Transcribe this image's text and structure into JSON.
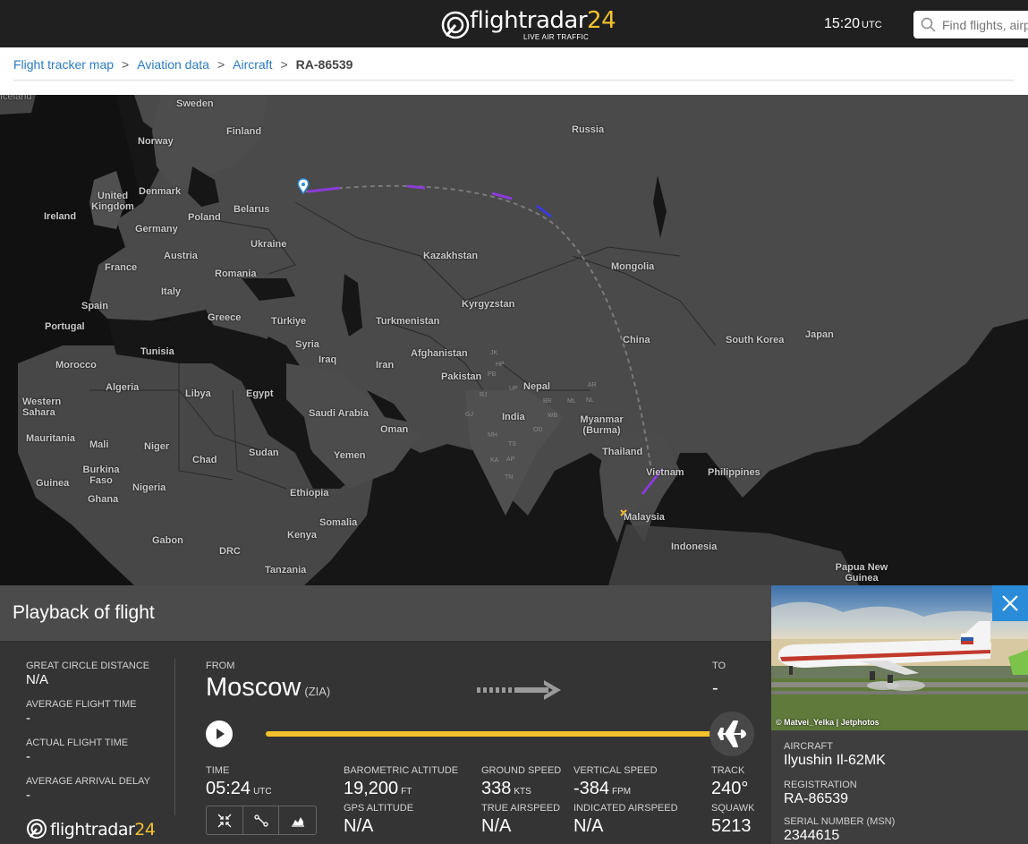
{
  "header": {
    "logo_text": "flightradar",
    "logo_num": "24",
    "logo_sub": "LIVE AIR TRAFFIC",
    "time": "15:20",
    "time_zone": "UTC",
    "search_placeholder": "Find flights, airports"
  },
  "breadcrumb": {
    "items": [
      "Flight tracker map",
      "Aviation data",
      "Aircraft"
    ],
    "current": "RA-86539",
    "separator": ">"
  },
  "map": {
    "countries": [
      "Iceland",
      "Sweden",
      "Finland",
      "Norway",
      "Russia",
      "United Kingdom",
      "Denmark",
      "Ireland",
      "Belarus",
      "Poland",
      "Germany",
      "Ukraine",
      "France",
      "Austria",
      "Romania",
      "Kazakhstan",
      "Mongolia",
      "Italy",
      "Spain",
      "Greece",
      "Portugal",
      "Türkiye",
      "Turkmenistan",
      "Kyrgyzstan",
      "Syria",
      "Tunisia",
      "Iraq",
      "Afghanistan",
      "Iran",
      "Morocco",
      "Algeria",
      "Libya",
      "Egypt",
      "Pakistan",
      "Nepal",
      "China",
      "South Korea",
      "Japan",
      "Western Sahara",
      "India",
      "Saudi Arabia",
      "Oman",
      "Myanmar (Burma)",
      "Mauritania",
      "Mali",
      "Niger",
      "Chad",
      "Sudan",
      "Yemen",
      "Thailand",
      "Burkina Faso",
      "Guinea",
      "Nigeria",
      "Ethiopia",
      "Ghana",
      "Vietnam",
      "Philippines",
      "Somalia",
      "Malaysia",
      "Gabon",
      "Kenya",
      "DRC",
      "Indonesia",
      "Tanzania",
      "Papua New Guinea"
    ],
    "states": [
      "JK",
      "HP",
      "PB",
      "UP",
      "RJ",
      "GJ",
      "MH",
      "TS",
      "KA",
      "AP",
      "TN",
      "BR",
      "WB",
      "AR",
      "ML",
      "NL",
      "OD"
    ]
  },
  "playback": {
    "title": "Playback of flight",
    "great_circle_label": "GREAT CIRCLE DISTANCE",
    "great_circle_value": "N/A",
    "avg_flight_time_label": "AVERAGE FLIGHT TIME",
    "avg_flight_time_value": "-",
    "actual_flight_time_label": "ACTUAL FLIGHT TIME",
    "actual_flight_time_value": "-",
    "avg_arrival_delay_label": "AVERAGE ARRIVAL DELAY",
    "avg_arrival_delay_value": "-",
    "from_label": "FROM",
    "from_city": "Moscow",
    "from_code": "(ZIA)",
    "to_label": "TO",
    "to_value": "-",
    "progress": 1.0,
    "time_label": "TIME",
    "time_value": "05:24",
    "time_unit": "UTC",
    "baro_alt_label": "BAROMETRIC ALTITUDE",
    "baro_alt_value": "19,200",
    "baro_alt_unit": "FT",
    "gps_alt_label": "GPS ALTITUDE",
    "gps_alt_value": "N/A",
    "ground_speed_label": "GROUND SPEED",
    "ground_speed_value": "338",
    "ground_speed_unit": "KTS",
    "true_airspeed_label": "TRUE AIRSPEED",
    "true_airspeed_value": "N/A",
    "vertical_speed_label": "VERTICAL SPEED",
    "vertical_speed_value": "-384",
    "vertical_speed_unit": "FPM",
    "indicated_airspeed_label": "INDICATED AIRSPEED",
    "indicated_airspeed_value": "N/A",
    "track_label": "TRACK",
    "track_value": "240°",
    "squawk_label": "SQUAWK",
    "squawk_value": "5213",
    "footer_logo_text": "flightradar",
    "footer_logo_num": "24"
  },
  "aircraft": {
    "photo_credit": "© Matvei_Yelka | Jetphotos",
    "aircraft_label": "AIRCRAFT",
    "aircraft_value": "Ilyushin Il-62MK",
    "registration_label": "REGISTRATION",
    "registration_value": "RA-86539",
    "serial_label": "SERIAL NUMBER (MSN)",
    "serial_value": "2344615"
  },
  "colors": {
    "accent_yellow": "#f5c12e",
    "link_blue": "#2c7bc0",
    "close_blue": "#2a8bd8",
    "track_purple": "#8a3bd8"
  }
}
